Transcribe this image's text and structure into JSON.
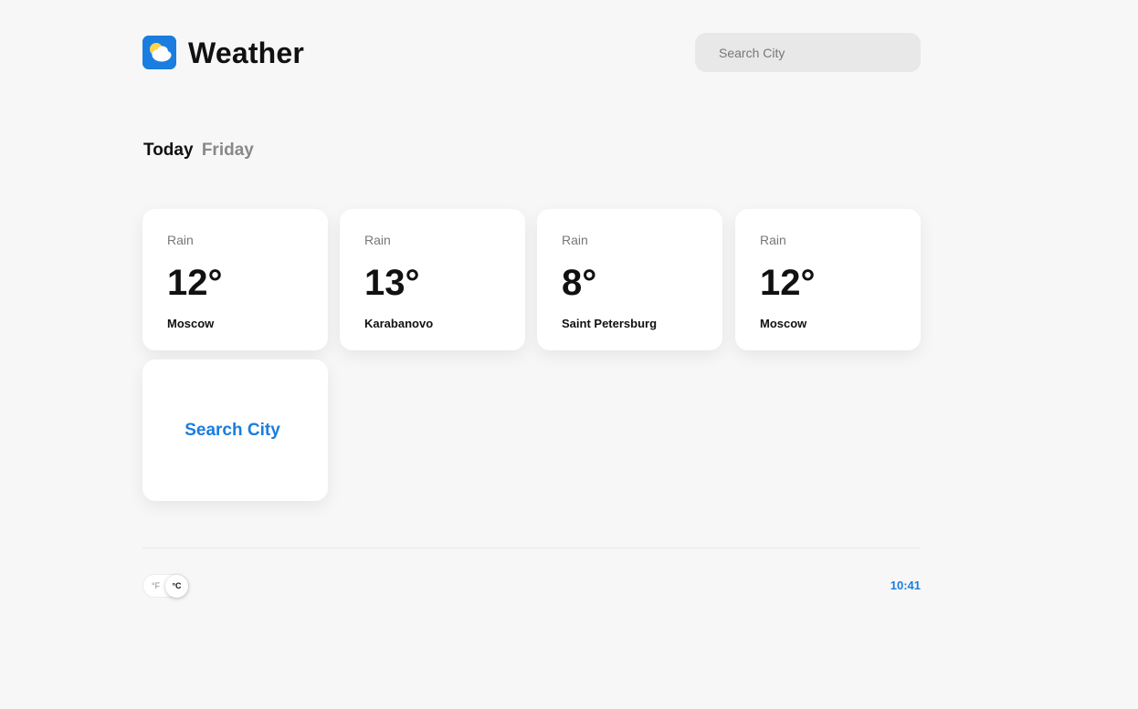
{
  "header": {
    "app_title": "Weather",
    "logo_icon": "weather-cloud-sun-icon",
    "search_placeholder": "Search City"
  },
  "day": {
    "today_label": "Today",
    "weekday": "Friday"
  },
  "cards": [
    {
      "condition": "Rain",
      "temp": "12°",
      "city": "Moscow"
    },
    {
      "condition": "Rain",
      "temp": "13°",
      "city": "Karabanovo"
    },
    {
      "condition": "Rain",
      "temp": "8°",
      "city": "Saint Petersburg"
    },
    {
      "condition": "Rain",
      "temp": "12°",
      "city": "Moscow"
    }
  ],
  "add_card": {
    "label": "Search City"
  },
  "footer": {
    "unit_f": "°F",
    "unit_c": "°C",
    "selected_unit": "°C",
    "time": "10:41"
  },
  "colors": {
    "accent": "#1a7de0",
    "background": "#f7f7f7",
    "card": "#ffffff",
    "search_bg": "#e8e8e8"
  }
}
